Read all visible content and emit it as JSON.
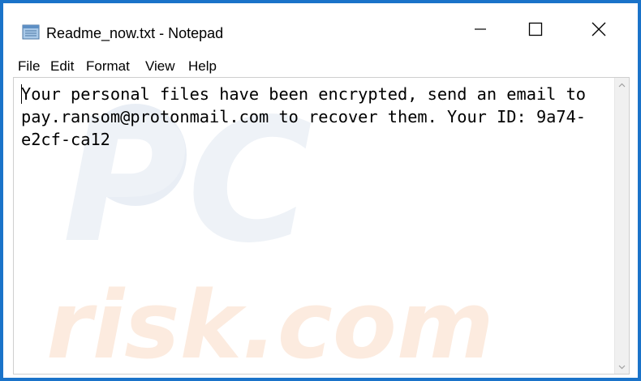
{
  "window": {
    "title": "Readme_now.txt - Notepad",
    "app_icon": "notepad-icon",
    "controls": {
      "minimize_icon": "minimize-icon",
      "maximize_icon": "maximize-icon",
      "close_icon": "close-icon"
    }
  },
  "menu": {
    "items": [
      "File",
      "Edit",
      "Format",
      "View",
      "Help"
    ]
  },
  "editor": {
    "content": "Your personal files have been encrypted, send an email to pay.ransom@protonmail.com to recover them. Your ID: 9a74-e2cf-ca12"
  },
  "watermark": {
    "text_top": "PC",
    "text_bottom": "risk.com"
  },
  "colors": {
    "window_border": "#1a73c9",
    "watermark": "#e9eef5",
    "watermark_accent": "#fbe6d6"
  }
}
